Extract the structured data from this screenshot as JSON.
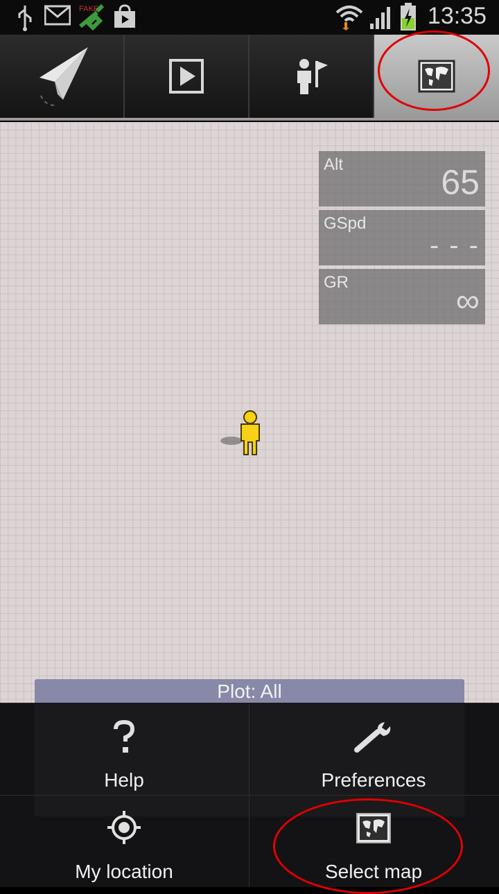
{
  "status_bar": {
    "icons": [
      "usb-icon",
      "gmail-icon",
      "fake-gps-icon",
      "play-store-icon",
      "wifi-icon",
      "signal-icon",
      "battery-charging-icon"
    ],
    "fake_label": "FAKE",
    "time": "13:35"
  },
  "tabs": [
    {
      "icon": "paper-plane-icon",
      "selected": false
    },
    {
      "icon": "play-icon",
      "selected": false
    },
    {
      "icon": "person-flag-icon",
      "selected": false
    },
    {
      "icon": "map-icon",
      "selected": true
    }
  ],
  "stats": [
    {
      "label": "Alt",
      "value": "65"
    },
    {
      "label": "GSpd",
      "value": "- - -"
    },
    {
      "label": "GR",
      "value": "∞"
    }
  ],
  "plot": {
    "label": "Plot: All"
  },
  "menu": {
    "items": [
      {
        "label": "Help",
        "icon": "question-mark-icon"
      },
      {
        "label": "Preferences",
        "icon": "wrench-icon"
      },
      {
        "label": "My location",
        "icon": "crosshair-icon"
      },
      {
        "label": "Select map",
        "icon": "map-icon"
      }
    ]
  },
  "colors": {
    "annotation": "#e00000",
    "plot_bar": "#8888a8",
    "battery": "#8bd02e"
  }
}
